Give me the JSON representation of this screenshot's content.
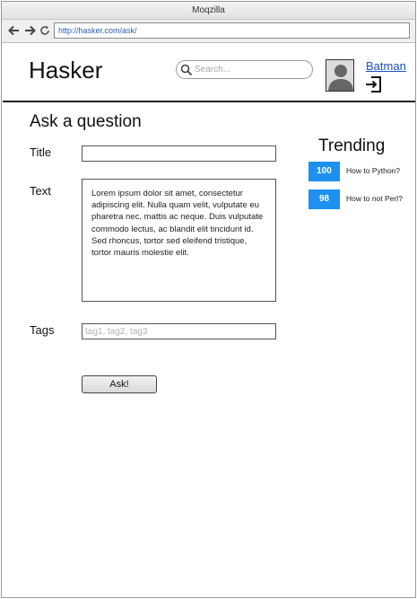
{
  "browser": {
    "window_title": "Moqzilla",
    "url": "http://hasker.com/ask/"
  },
  "header": {
    "logo": "Hasker",
    "search_placeholder": "Search...",
    "username": "Batman"
  },
  "form": {
    "heading": "Ask a question",
    "title_label": "Title",
    "title_value": "",
    "text_label": "Text",
    "text_value": "Lorem ipsum dolor sit amet, consectetur adipiscing elit. Nulla quam velit, vulputate eu pharetra nec, mattis ac neque. Duis vulputate commodo lectus, ac blandit elit tincidunt id. Sed rhoncus, tortor sed eleifend tristique, tortor mauris molestie elit.",
    "tags_label": "Tags",
    "tags_placeholder": "tag1, tag2, tag3",
    "submit_label": "Ask!"
  },
  "trending": {
    "title": "Trending",
    "items": [
      {
        "votes": "100",
        "title": "How to Python?"
      },
      {
        "votes": "98",
        "title": "How to not Perl?"
      }
    ]
  },
  "colors": {
    "badge": "#1e90ef",
    "link": "#1a4fc4"
  }
}
